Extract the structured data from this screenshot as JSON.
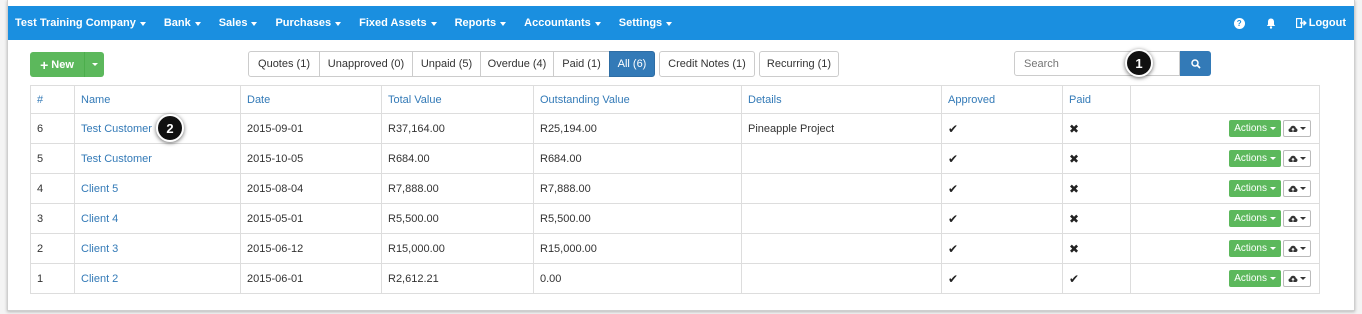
{
  "nav": {
    "items": [
      {
        "label": "Test Training Company"
      },
      {
        "label": "Bank"
      },
      {
        "label": "Sales"
      },
      {
        "label": "Purchases"
      },
      {
        "label": "Fixed Assets"
      },
      {
        "label": "Reports"
      },
      {
        "label": "Accountants"
      },
      {
        "label": "Settings"
      }
    ],
    "help_icon": "question-circle-icon",
    "bell_icon": "bell-icon",
    "logout_label": "Logout"
  },
  "toolbar": {
    "new_label": "New",
    "filters": [
      {
        "label": "Quotes (1)"
      },
      {
        "label": "Unapproved (0)"
      },
      {
        "label": "Unpaid (5)"
      },
      {
        "label": "Overdue (4)"
      },
      {
        "label": "Paid (1)"
      },
      {
        "label": "All (6)"
      },
      {
        "label": "Credit Notes (1)"
      },
      {
        "label": "Recurring (1)"
      }
    ],
    "active_filter": "All (6)",
    "search_placeholder": "Search"
  },
  "annotations": [
    "1",
    "2"
  ],
  "table": {
    "headers": [
      "#",
      "Name",
      "Date",
      "Total Value",
      "Outstanding Value",
      "Details",
      "Approved",
      "Paid"
    ],
    "rows": [
      {
        "num": "6",
        "name": "Test Customer",
        "date": "2015-09-01",
        "total": "R37,164.00",
        "outstanding": "R25,194.00",
        "details": "Pineapple Project",
        "approved": "✔",
        "paid": "✖"
      },
      {
        "num": "5",
        "name": "Test Customer",
        "date": "2015-10-05",
        "total": "R684.00",
        "outstanding": "R684.00",
        "details": "",
        "approved": "✔",
        "paid": "✖"
      },
      {
        "num": "4",
        "name": "Client 5",
        "date": "2015-08-04",
        "total": "R7,888.00",
        "outstanding": "R7,888.00",
        "details": "",
        "approved": "✔",
        "paid": "✖"
      },
      {
        "num": "3",
        "name": "Client 4",
        "date": "2015-05-01",
        "total": "R5,500.00",
        "outstanding": "R5,500.00",
        "details": "",
        "approved": "✔",
        "paid": "✖"
      },
      {
        "num": "2",
        "name": "Client 3",
        "date": "2015-06-12",
        "total": "R15,000.00",
        "outstanding": "R15,000.00",
        "details": "",
        "approved": "✔",
        "paid": "✖"
      },
      {
        "num": "1",
        "name": "Client 2",
        "date": "2015-06-01",
        "total": "R2,612.21",
        "outstanding": "0.00",
        "details": "",
        "approved": "✔",
        "paid": "✔"
      }
    ],
    "actions_label": "Actions"
  }
}
